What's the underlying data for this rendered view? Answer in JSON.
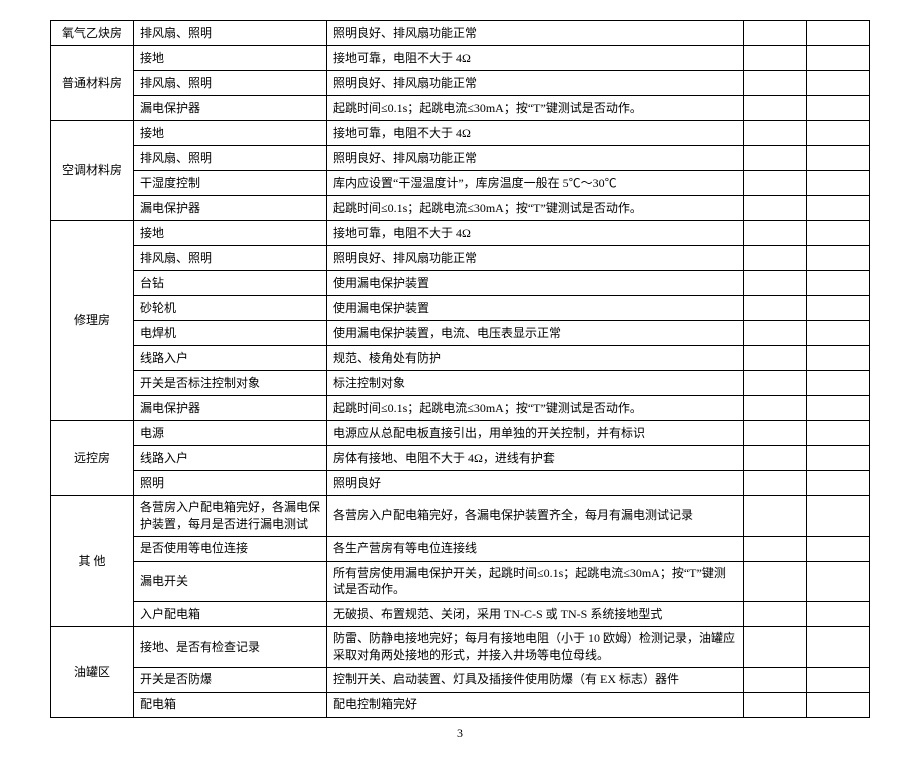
{
  "page_number": "3",
  "sections": [
    {
      "name": "氧气乙炔房",
      "rows": [
        {
          "item": "排风扇、照明",
          "standard": "照明良好、排风扇功能正常"
        }
      ]
    },
    {
      "name": "普通材料房",
      "rows": [
        {
          "item": "接地",
          "standard": "接地可靠，电阻不大于 4Ω"
        },
        {
          "item": "排风扇、照明",
          "standard": "照明良好、排风扇功能正常"
        },
        {
          "item": "漏电保护器",
          "standard": "起跳时间≤0.1s；起跳电流≤30mA；按“T”键测试是否动作。"
        }
      ]
    },
    {
      "name": "空调材料房",
      "rows": [
        {
          "item": "接地",
          "standard": "接地可靠，电阻不大于 4Ω"
        },
        {
          "item": "排风扇、照明",
          "standard": "照明良好、排风扇功能正常"
        },
        {
          "item": "干湿度控制",
          "standard": "库内应设置“干湿温度计”，库房温度一般在 5℃～30℃"
        },
        {
          "item": "漏电保护器",
          "standard": "起跳时间≤0.1s；起跳电流≤30mA；按“T”键测试是否动作。"
        }
      ]
    },
    {
      "name": "修理房",
      "rows": [
        {
          "item": "接地",
          "standard": "接地可靠，电阻不大于 4Ω"
        },
        {
          "item": "排风扇、照明",
          "standard": "照明良好、排风扇功能正常"
        },
        {
          "item": "台钻",
          "standard": "使用漏电保护装置"
        },
        {
          "item": "砂轮机",
          "standard": "使用漏电保护装置"
        },
        {
          "item": "电焊机",
          "standard": "使用漏电保护装置，电流、电压表显示正常"
        },
        {
          "item": "线路入户",
          "standard": "规范、棱角处有防护"
        },
        {
          "item": "开关是否标注控制对象",
          "standard": "标注控制对象"
        },
        {
          "item": "漏电保护器",
          "standard": "起跳时间≤0.1s；起跳电流≤30mA；按“T”键测试是否动作。"
        }
      ]
    },
    {
      "name": "远控房",
      "rows": [
        {
          "item": "电源",
          "standard": "电源应从总配电板直接引出，用单独的开关控制，并有标识"
        },
        {
          "item": "线路入户",
          "standard": "房体有接地、电阻不大于 4Ω，进线有护套"
        },
        {
          "item": "照明",
          "standard": "照明良好"
        }
      ]
    },
    {
      "name": "其  他",
      "rows": [
        {
          "item": "各营房入户配电箱完好，各漏电保护装置，每月是否进行漏电测试",
          "standard": "各营房入户配电箱完好，各漏电保护装置齐全，每月有漏电测试记录"
        },
        {
          "item": "是否使用等电位连接",
          "standard": "各生产营房有等电位连接线"
        },
        {
          "item": "漏电开关",
          "standard": "所有营房使用漏电保护开关，起跳时间≤0.1s；起跳电流≤30mA；按“T”键测试是否动作。"
        },
        {
          "item": "入户配电箱",
          "standard": "无破损、布置规范、关闭，采用 TN-C-S 或 TN-S 系统接地型式"
        }
      ]
    },
    {
      "name": "油罐区",
      "rows": [
        {
          "item": "接地、是否有检查记录",
          "standard": "防雷、防静电接地完好；每月有接地电阻（小于 10 欧姆）检测记录，油罐应采取对角两处接地的形式，并接入井场等电位母线。"
        },
        {
          "item": "开关是否防爆",
          "standard": "控制开关、启动装置、灯具及插接件使用防爆（有 EX 标志）器件"
        },
        {
          "item": "配电箱",
          "standard": "配电控制箱完好"
        }
      ]
    }
  ]
}
